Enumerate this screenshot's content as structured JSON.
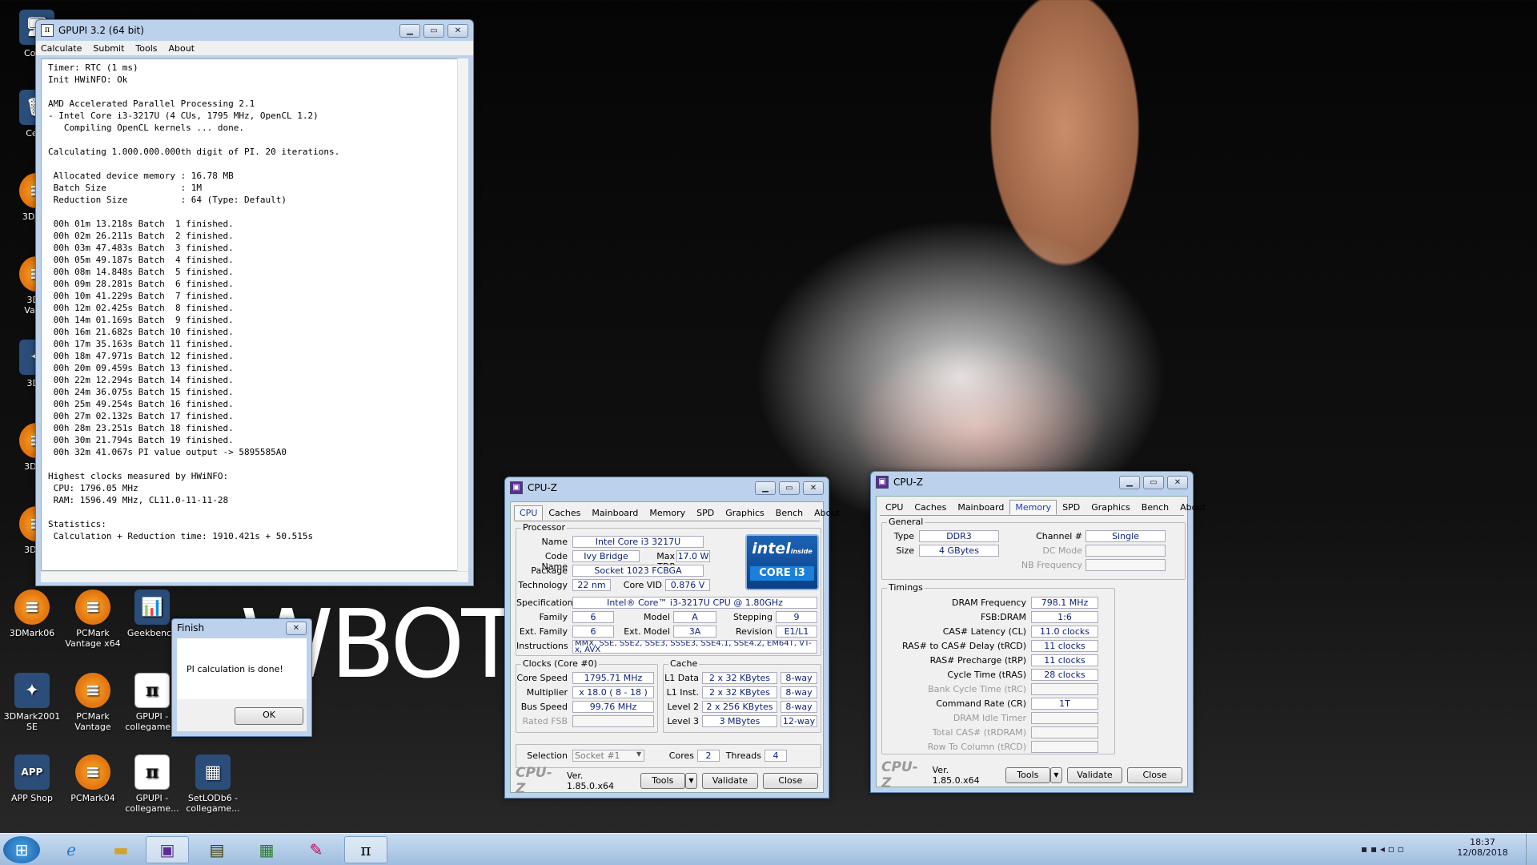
{
  "desktop": {
    "icons": [
      {
        "label": "Comp",
        "glyph": "🖥"
      },
      {
        "label": "Cesti",
        "glyph": "🗑"
      },
      {
        "label": "3DMar",
        "glyph": ""
      },
      {
        "label": "3DM\nVanta",
        "glyph": ""
      },
      {
        "label": "3DM",
        "glyph": "✦"
      },
      {
        "label": "3DMa",
        "glyph": ""
      },
      {
        "label": "3DMa",
        "glyph": ""
      },
      {
        "label": "3DMark06",
        "glyph": ""
      },
      {
        "label": "PCMark Vantage x64",
        "glyph": ""
      },
      {
        "label": "Geekbench",
        "glyph": "📊"
      },
      {
        "label": "3DMark2001 SE",
        "glyph": "✦"
      },
      {
        "label": "PCMark Vantage",
        "glyph": ""
      },
      {
        "label": "GPUPI - collegame...",
        "glyph": "π"
      },
      {
        "label": "APP Shop",
        "glyph": "APP"
      },
      {
        "label": "PCMark04",
        "glyph": ""
      },
      {
        "label": "GPUPI - collegame...",
        "glyph": "π"
      },
      {
        "label": "SetLODb6 - collegame...",
        "glyph": "▦"
      }
    ],
    "watermark": "WBOT I"
  },
  "gpupi": {
    "title": "GPUPI 3.2 (64 bit)",
    "menu": [
      "Calculate",
      "Submit",
      "Tools",
      "About"
    ],
    "console_lines": [
      "Timer: RTC (1 ms)",
      "Init HWiNFO: Ok",
      "",
      "AMD Accelerated Parallel Processing 2.1",
      "- Intel Core i3-3217U (4 CUs, 1795 MHz, OpenCL 1.2)",
      "   Compiling OpenCL kernels ... done.",
      "",
      "Calculating 1.000.000.000th digit of PI. 20 iterations.",
      "",
      " Allocated device memory : 16.78 MB",
      " Batch Size              : 1M",
      " Reduction Size          : 64 (Type: Default)",
      "",
      " 00h 01m 13.218s Batch  1 finished.",
      " 00h 02m 26.211s Batch  2 finished.",
      " 00h 03m 47.483s Batch  3 finished.",
      " 00h 05m 49.187s Batch  4 finished.",
      " 00h 08m 14.848s Batch  5 finished.",
      " 00h 09m 28.281s Batch  6 finished.",
      " 00h 10m 41.229s Batch  7 finished.",
      " 00h 12m 02.425s Batch  8 finished.",
      " 00h 14m 01.169s Batch  9 finished.",
      " 00h 16m 21.682s Batch 10 finished.",
      " 00h 17m 35.163s Batch 11 finished.",
      " 00h 18m 47.971s Batch 12 finished.",
      " 00h 20m 09.459s Batch 13 finished.",
      " 00h 22m 12.294s Batch 14 finished.",
      " 00h 24m 36.075s Batch 15 finished.",
      " 00h 25m 49.254s Batch 16 finished.",
      " 00h 27m 02.132s Batch 17 finished.",
      " 00h 28m 23.251s Batch 18 finished.",
      " 00h 30m 21.794s Batch 19 finished.",
      " 00h 32m 41.067s PI value output -> 5895585A0",
      "",
      "Highest clocks measured by HWiNFO:",
      " CPU: 1796.05 MHz",
      " RAM: 1596.49 MHz, CL11.0-11-11-28",
      "",
      "Statistics:",
      " Calculation + Reduction time: 1910.421s + 50.515s"
    ]
  },
  "finish": {
    "title": "Finish",
    "message": "PI calculation is done!",
    "ok": "OK"
  },
  "cpuz_cpu": {
    "title": "CPU-Z",
    "tabs": [
      "CPU",
      "Caches",
      "Mainboard",
      "Memory",
      "SPD",
      "Graphics",
      "Bench",
      "About"
    ],
    "active_tab": "CPU",
    "processor_group": "Processor",
    "name_label": "Name",
    "name": "Intel Core i3 3217U",
    "codename_label": "Code Name",
    "codename": "Ivy Bridge",
    "maxtdp_label": "Max TDP",
    "maxtdp": "17.0 W",
    "package_label": "Package",
    "package": "Socket 1023 FCBGA",
    "technology_label": "Technology",
    "technology": "22 nm",
    "corevid_label": "Core VID",
    "corevid": "0.876 V",
    "spec_label": "Specification",
    "spec": "Intel® Core™ i3-3217U CPU @ 1.80GHz",
    "family_label": "Family",
    "family": "6",
    "model_label": "Model",
    "model": "A",
    "stepping_label": "Stepping",
    "stepping": "9",
    "extfamily_label": "Ext. Family",
    "extfamily": "6",
    "extmodel_label": "Ext. Model",
    "extmodel": "3A",
    "revision_label": "Revision",
    "revision": "E1/L1",
    "instr_label": "Instructions",
    "instr": "MMX, SSE, SSE2, SSE3, SSSE3, SSE4.1, SSE4.2, EM64T, VT-x, AVX",
    "clocks_group": "Clocks (Core #0)",
    "corespeed_label": "Core Speed",
    "corespeed": "1795.71 MHz",
    "multiplier_label": "Multiplier",
    "multiplier": "x 18.0 ( 8 - 18 )",
    "busspeed_label": "Bus Speed",
    "busspeed": "99.76 MHz",
    "ratedfsb_label": "Rated FSB",
    "cache_group": "Cache",
    "l1d_label": "L1 Data",
    "l1d": "2 x 32 KBytes",
    "l1d_way": "8-way",
    "l1i_label": "L1 Inst.",
    "l1i": "2 x 32 KBytes",
    "l1i_way": "8-way",
    "l2_label": "Level 2",
    "l2": "2 x 256 KBytes",
    "l2_way": "8-way",
    "l3_label": "Level 3",
    "l3": "3 MBytes",
    "l3_way": "12-way",
    "selection_label": "Selection",
    "selection": "Socket #1",
    "cores_label": "Cores",
    "cores": "2",
    "threads_label": "Threads",
    "threads": "4",
    "intel_brand": "intel",
    "intel_inside": "inside",
    "intel_core": "CORE i3"
  },
  "cpuz_mem": {
    "title": "CPU-Z",
    "tabs": [
      "CPU",
      "Caches",
      "Mainboard",
      "Memory",
      "SPD",
      "Graphics",
      "Bench",
      "About"
    ],
    "active_tab": "Memory",
    "general_group": "General",
    "type_label": "Type",
    "type": "DDR3",
    "size_label": "Size",
    "size": "4 GBytes",
    "channel_label": "Channel #",
    "channel": "Single",
    "dcmode_label": "DC Mode",
    "nbfreq_label": "NB Frequency",
    "timings_group": "Timings",
    "dramfreq_label": "DRAM Frequency",
    "dramfreq": "798.1 MHz",
    "fsbdram_label": "FSB:DRAM",
    "fsbdram": "1:6",
    "cl_label": "CAS# Latency (CL)",
    "cl": "11.0 clocks",
    "trcd_label": "RAS# to CAS# Delay (tRCD)",
    "trcd": "11 clocks",
    "trp_label": "RAS# Precharge (tRP)",
    "trp": "11 clocks",
    "tras_label": "Cycle Time (tRAS)",
    "tras": "28 clocks",
    "trc_label": "Bank Cycle Time (tRC)",
    "cr_label": "Command Rate (CR)",
    "cr": "1T",
    "idle_label": "DRAM Idle Timer",
    "trdram_label": "Total CAS# (tRDRAM)",
    "trcd2_label": "Row To Column (tRCD)"
  },
  "cpuz_footer": {
    "logo": "CPU-Z",
    "version": "Ver. 1.85.0.x64",
    "tools": "Tools",
    "validate": "Validate",
    "close": "Close"
  },
  "taskbar": {
    "time": "18:37",
    "date": "12/08/2018",
    "buttons": [
      "start",
      "ie",
      "explorer",
      "cpuz",
      "gpuz",
      "hwinfo",
      "paint",
      "gpupi"
    ]
  }
}
